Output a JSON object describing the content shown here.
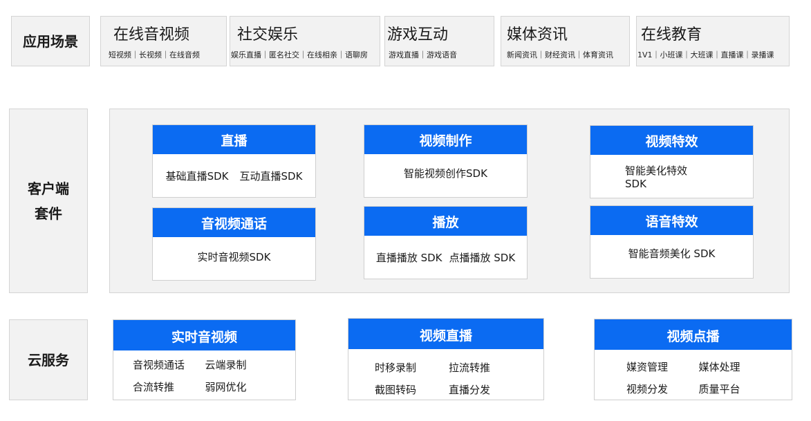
{
  "scenes": {
    "label": "应用场景",
    "items": [
      {
        "title": "在线音视频",
        "sub": "短视频｜长视频｜在线音频"
      },
      {
        "title": "社交娱乐",
        "sub": "娱乐直播｜匿名社交｜在线相亲｜语聊房"
      },
      {
        "title": "游戏互动",
        "sub": "游戏直播｜游戏语音"
      },
      {
        "title": "媒体资讯",
        "sub": "新闻资讯｜财经资讯｜体育资讯"
      },
      {
        "title": "在线教育",
        "sub": "1V1｜小班课｜大班课｜直播课｜录播课"
      }
    ]
  },
  "client": {
    "label_line1": "客户端",
    "label_line2": "套件",
    "cards": [
      {
        "title": "直播",
        "items": [
          "基础直播SDK",
          "互动直播SDK"
        ]
      },
      {
        "title": "视频制作",
        "items": [
          "智能视频创作SDK"
        ]
      },
      {
        "title": "视频特效",
        "items": [
          "智能美化特效",
          "SDK"
        ]
      },
      {
        "title": "音视频通话",
        "items": [
          "实时音视频SDK"
        ]
      },
      {
        "title": "播放",
        "items": [
          "直播播放 SDK",
          "点播播放 SDK"
        ]
      },
      {
        "title": "语音特效",
        "items": [
          "智能音频美化 SDK"
        ]
      }
    ]
  },
  "cloud": {
    "label": "云服务",
    "cards": [
      {
        "title": "实时音视频",
        "items": [
          "音视频通话",
          "云端录制",
          "合流转推",
          "弱网优化"
        ]
      },
      {
        "title": "视频直播",
        "items": [
          "时移录制",
          "拉流转推",
          "截图转码",
          "直播分发"
        ]
      },
      {
        "title": "视频点播",
        "items": [
          "媒资管理",
          "媒体处理",
          "视频分发",
          "质量平台"
        ]
      }
    ]
  },
  "colors": {
    "accent": "#0b6bf2",
    "panel": "#f2f2f2",
    "border": "#d4d4d4"
  }
}
